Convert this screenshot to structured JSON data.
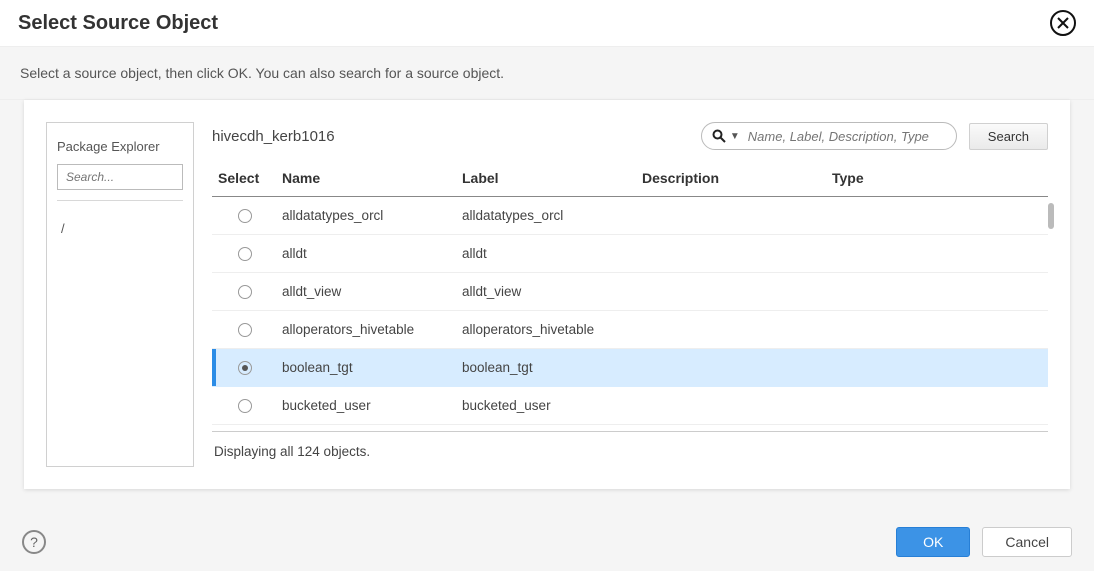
{
  "dialog": {
    "title": "Select Source Object",
    "instruction": "Select a source object, then click OK. You can also search for a source object."
  },
  "package_explorer": {
    "title": "Package Explorer",
    "search_placeholder": "Search...",
    "folder_path": "/"
  },
  "context_name": "hivecdh_kerb1016",
  "search": {
    "placeholder": "Name, Label, Description, Type",
    "button": "Search"
  },
  "columns": {
    "select": "Select",
    "name": "Name",
    "label": "Label",
    "description": "Description",
    "type": "Type"
  },
  "rows": [
    {
      "name": "alldatatypes_orcl",
      "label": "alldatatypes_orcl",
      "description": "",
      "type": "",
      "selected": false
    },
    {
      "name": "alldt",
      "label": "alldt",
      "description": "",
      "type": "",
      "selected": false
    },
    {
      "name": "alldt_view",
      "label": "alldt_view",
      "description": "",
      "type": "",
      "selected": false
    },
    {
      "name": "alloperators_hivetable",
      "label": "alloperators_hivetable",
      "description": "",
      "type": "",
      "selected": false
    },
    {
      "name": "boolean_tgt",
      "label": "boolean_tgt",
      "description": "",
      "type": "",
      "selected": true
    },
    {
      "name": "bucketed_user",
      "label": "bucketed_user",
      "description": "",
      "type": "",
      "selected": false
    }
  ],
  "status": "Displaying all 124 objects.",
  "buttons": {
    "ok": "OK",
    "cancel": "Cancel"
  }
}
